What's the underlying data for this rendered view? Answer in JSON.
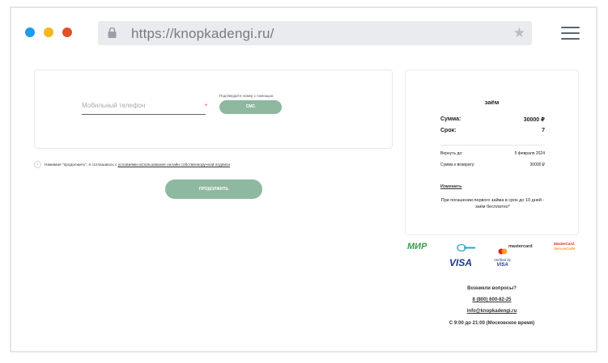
{
  "browser": {
    "url": "https://knopkadengi.ru/",
    "dots": [
      "#1e9de6",
      "#f2b81f",
      "#e2502a"
    ]
  },
  "form": {
    "phone_placeholder": "Мобильный телефон",
    "required_mark": "*",
    "confirm_label": "Подтвердите номер с помощью:",
    "sms_button": "СМС",
    "consent_text": "Нажимая \"продолжить\", я соглашаюсь с ",
    "consent_link": "условиями использования онлайн собственноручной подписи",
    "continue_button": "ПРОДОЛЖИТЬ"
  },
  "summary": {
    "title": "заём",
    "amount_label": "Сумма:",
    "amount_value": "30000 ₽",
    "term_label": "Срок:",
    "term_value": "7",
    "return_by_label": "Вернуть до:",
    "return_by_value": "5 февраля 2024",
    "total_label": "Сумма к возврату:",
    "total_value": "30000 ₽",
    "change_link": "Изменить",
    "note": "При погашении первого займа в срок до 10 дней - заём бесплатно*"
  },
  "payments": {
    "mir": "МИР",
    "mastercard": "mastercard",
    "mc_securecode_1": "MasterCard.",
    "mc_securecode_2": "SecureCode",
    "visa": "VISA",
    "verified_1": "Verified by",
    "verified_2": "VISA"
  },
  "help": {
    "question": "Возникли вопросы?",
    "phone": "8 (800) 600-82-25",
    "email": "info@knopkadengi.ru",
    "hours": "С 9:00 до 21:00 (Московское время)"
  },
  "colors": {
    "accent": "#8fb8a1",
    "required": "#e5533b"
  }
}
